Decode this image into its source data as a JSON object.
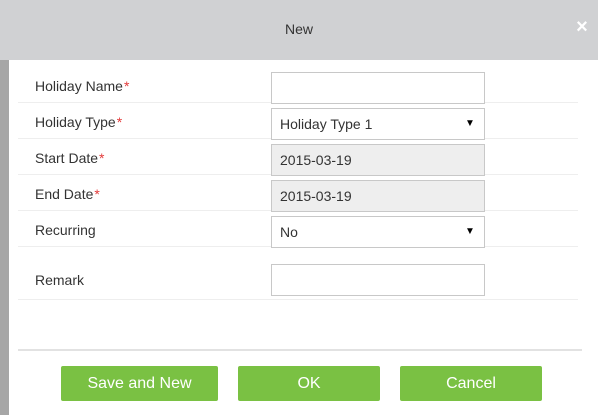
{
  "dialog": {
    "title": "New",
    "close_glyph": "×"
  },
  "form": {
    "required_mark": "*",
    "holiday_name": {
      "label": "Holiday Name",
      "value": ""
    },
    "holiday_type": {
      "label": "Holiday Type",
      "value": "Holiday Type 1",
      "arrow": "▼"
    },
    "start_date": {
      "label": "Start Date",
      "value": "2015-03-19"
    },
    "end_date": {
      "label": "End Date",
      "value": "2015-03-19"
    },
    "recurring": {
      "label": "Recurring",
      "value": "No",
      "arrow": "▼"
    },
    "remark": {
      "label": "Remark",
      "value": ""
    }
  },
  "buttons": {
    "save_and_new": "Save and New",
    "ok": "OK",
    "cancel": "Cancel"
  },
  "colors": {
    "titlebar": "#d0d1d3",
    "accent_green": "#7ac143",
    "required_red": "#e33a3a",
    "disabled_field": "#eeeeee"
  }
}
